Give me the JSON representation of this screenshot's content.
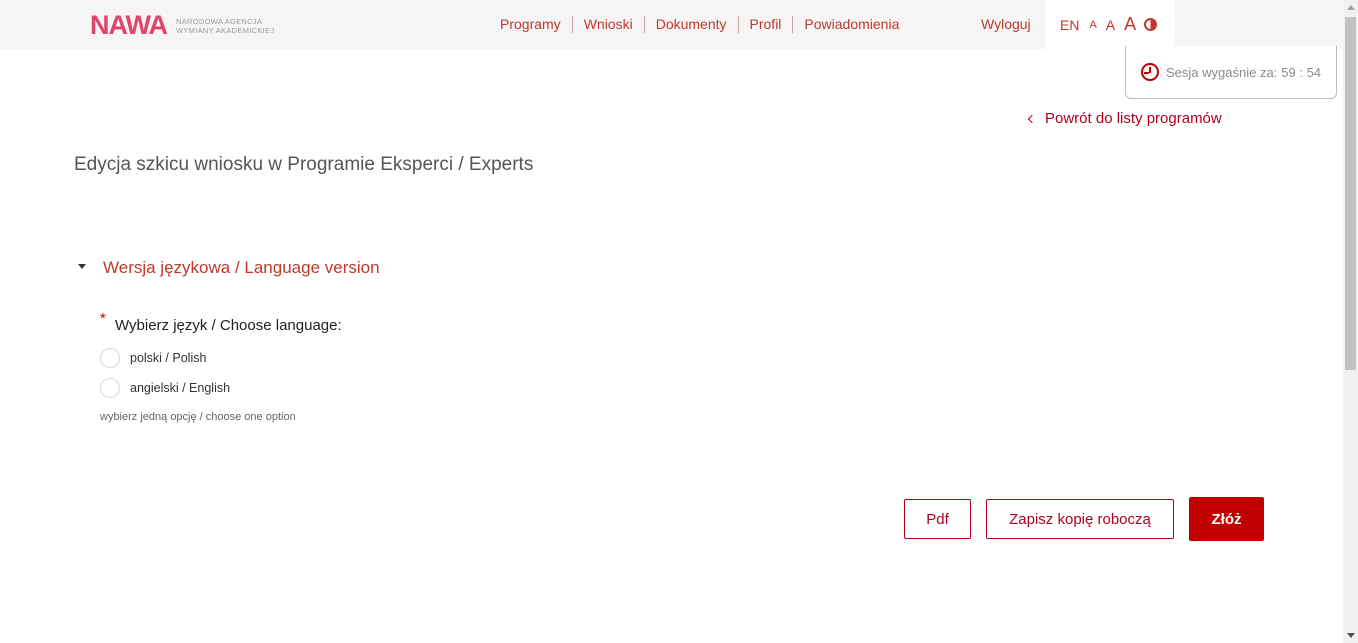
{
  "header": {
    "logo_text": "NAWA",
    "logo_sub_line1": "NARODOWA AGENCJA",
    "logo_sub_line2": "WYMIANY AKADEMICKIEJ",
    "nav": [
      "Programy",
      "Wnioski",
      "Dokumenty",
      "Profil",
      "Powiadomienia"
    ],
    "logout": "Wyloguj",
    "accessibility": {
      "lang": "EN",
      "font_small": "A",
      "font_medium": "A",
      "font_large": "A",
      "contrast_icon": "contrast-icon"
    }
  },
  "session": {
    "label": "Sesja wygaśnie za:",
    "time": "59 : 54",
    "icon": "clock-icon"
  },
  "back_link": "Powrót do listy programów",
  "page_title": "Edycja szkicu wniosku w Programie Eksperci / Experts",
  "section": {
    "title": "Wersja językowa / Language version",
    "required_mark": "*",
    "field_label": "Wybierz język / Choose language:",
    "options": [
      "polski / Polish",
      "angielski / English"
    ],
    "hint": "wybierz jedną opcję / choose one option"
  },
  "buttons": {
    "pdf": "Pdf",
    "save_draft": "Zapisz kopię roboczą",
    "submit": "Złóż"
  },
  "colors": {
    "accent": "#c0392b",
    "primary_button": "#c00000",
    "logo": "#e2456a"
  }
}
